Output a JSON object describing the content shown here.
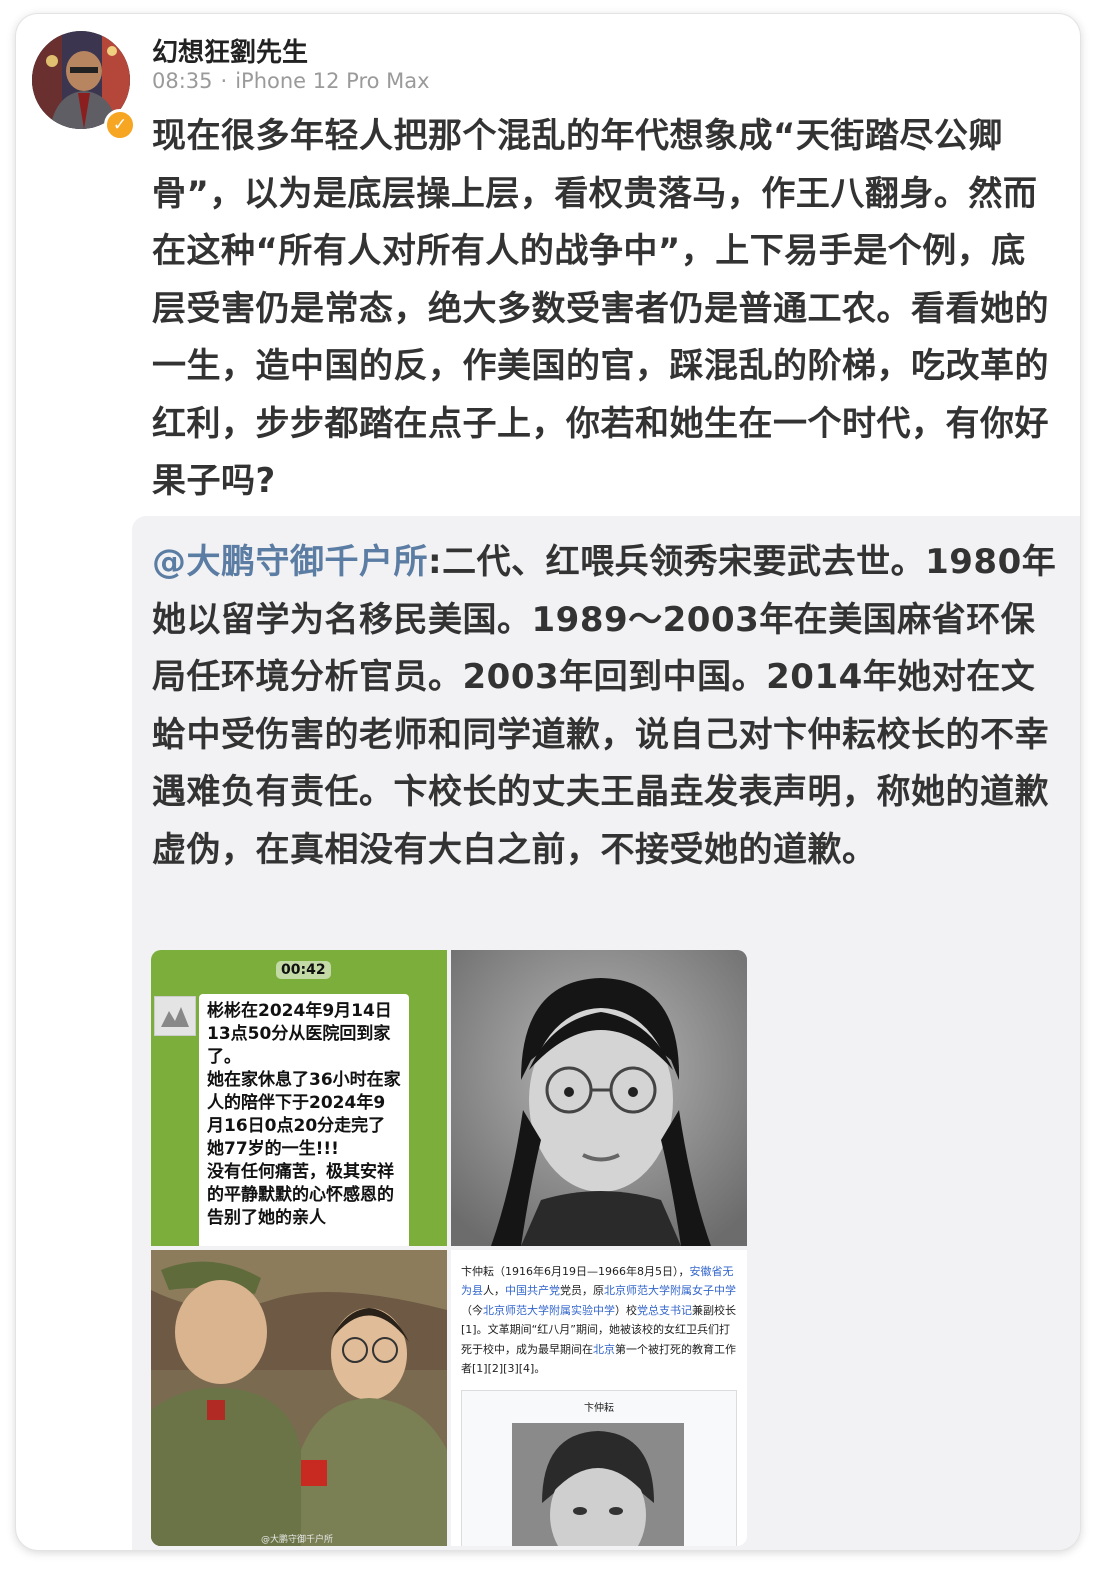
{
  "post": {
    "username": "幻想狂劉先生",
    "time": "08:35",
    "separator": "·",
    "device": "iPhone 12 Pro Max",
    "text": "现在很多年轻人把那个混乱的年代想象成“天街踏尽公卿骨”，以为是底层操上层，看权贵落马，作王八翻身。然而在这种“所有人对所有人的战争中”，上下易手是个例，底层受害仍是常态，绝大多数受害者仍是普通工农。看看她的一生，造中国的反，作美国的官，踩混乱的阶梯，吃改革的红利，步步都踏在点子上，你若和她生在一个时代，有你好果子吗?"
  },
  "repost": {
    "mention": "@大鹏守御千户所",
    "text": ":二代、红喂兵领秀宋要武去世。1980年她以留学为名移民美国。1989～2003年在美国麻省环保局任环境分析官员。2003年回到中国。2014年她对在文蛤中受伤害的老师和同学道歉，说自己对卞仲耘校长的不幸遇难负有责任。卞校长的丈夫王晶垚发表声明，称她的道歉虚伪，在真相没有大白之前，不接受她的道歉。",
    "images": {
      "chat": {
        "time": "00:42",
        "message": "彬彬在2024年9月14日13点50分从医院回到家了。\n她在家休息了36小时在家人的陪伴下于2024年9月16日0点20分走完了她77岁的一生!!!\n没有任何痛苦，极其安祥的平静默默的心怀感恩的告别了她的亲人"
      },
      "wiki": {
        "name": "卞仲耘",
        "dates": "（1916年6月19日—1966年8月5日），",
        "link1": "安徽省无为县",
        "mid1": "人，",
        "link2": "中国共产党",
        "mid2": "党员，原",
        "link3": "北京师范大学附属女子中学",
        "mid3": "（今",
        "link4": "北京师范大学附属实验中学",
        "mid4": "）校",
        "link5": "党总支书记",
        "mid5": "兼副校长[1]。文革期间“红八月”期间，她被该校的女红卫兵们打死于校中，成为最早期间在",
        "link6": "北京",
        "tail": "第一个被打死的教育工作者[1][2][3][4]。",
        "caption": "卞仲耘"
      },
      "watermark": "@大鹏守御千户所"
    }
  },
  "colors": {
    "mention": "#5b7da3",
    "verified_badge": "#f6a623",
    "repost_background": "#f2f2f4"
  }
}
